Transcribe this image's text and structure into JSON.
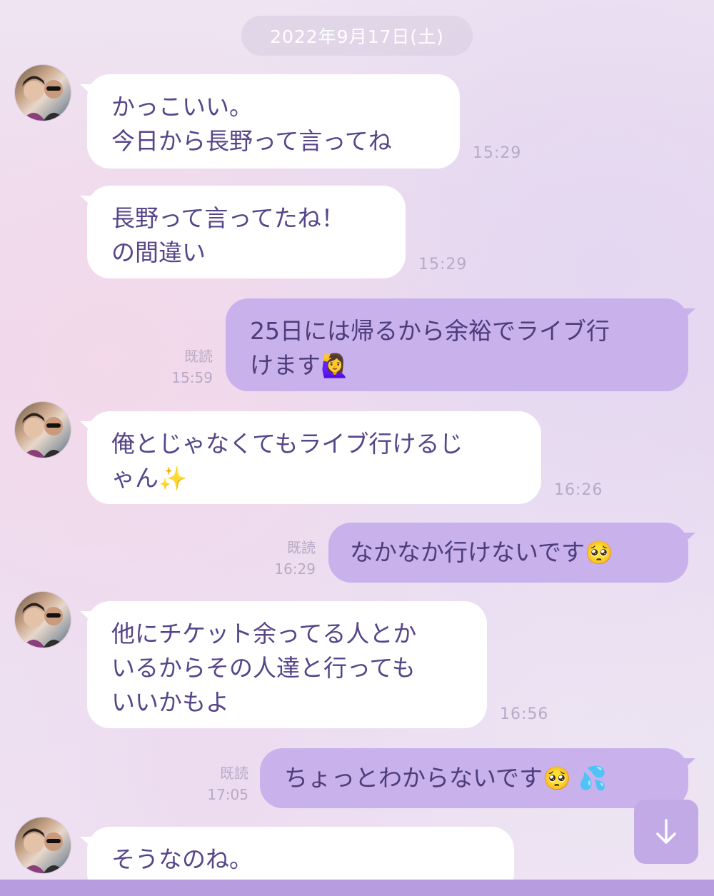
{
  "date_label": "2022年9月17日(土)",
  "messages": [
    {
      "lines": [
        "かっこいい。",
        "今日から長野って言ってね"
      ],
      "time": "15:29"
    },
    {
      "lines": [
        "長野って言ってたね！",
        "の間違い"
      ],
      "time": "15:29"
    },
    {
      "lines": [
        "25日には帰るから余裕でライブ行",
        "けます"
      ],
      "emoji": "🙋‍♀️",
      "read": "既読",
      "time": "15:59"
    },
    {
      "lines": [
        "俺とじゃなくてもライブ行けるじ",
        "ゃん"
      ],
      "emoji": "✨",
      "time": "16:26"
    },
    {
      "lines": [
        "なかなか行けないです"
      ],
      "emoji": "🥺",
      "read": "既読",
      "time": "16:29"
    },
    {
      "lines": [
        "他にチケット余ってる人とか",
        "いるからその人達と行っても",
        "いいかもよ"
      ],
      "time": "16:56"
    },
    {
      "lines": [
        "ちょっとわからないです"
      ],
      "emoji": "🥺 💦",
      "read": "既読",
      "time": "17:05"
    },
    {
      "lines": [
        "そうなのね。"
      ]
    }
  ],
  "icons": {
    "scroll_down": "arrow-down-icon",
    "avatar": "avatar-photo"
  },
  "colors": {
    "outgoing_bubble": "#c9b1ec",
    "incoming_bubble": "#ffffff",
    "text": "#55468a",
    "accent": "#b79ce0"
  }
}
